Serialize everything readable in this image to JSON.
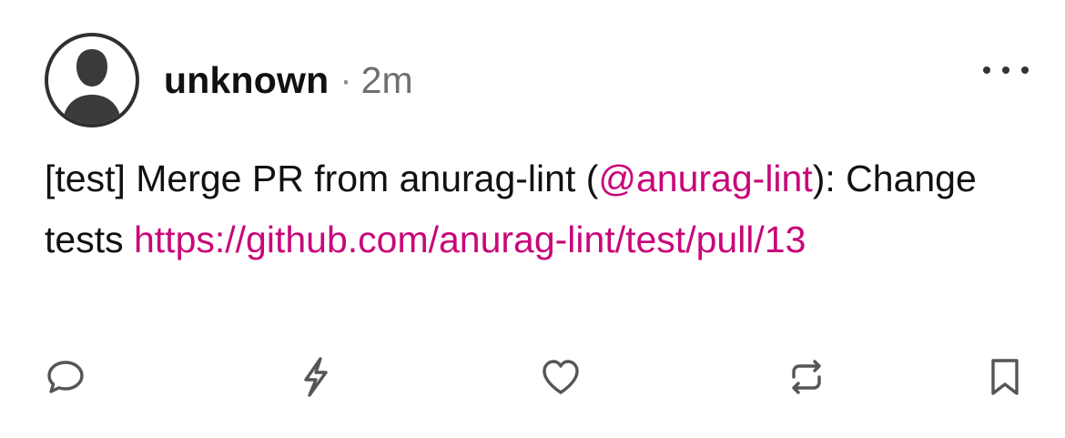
{
  "post": {
    "username": "unknown",
    "separator": "·",
    "time": "2m",
    "text_prefix": "[test] Merge PR from anurag-lint (",
    "mention": "@anurag-lint",
    "text_middle": "): Change tests ",
    "link": "https://github.com/anurag-lint/test/pull/13"
  },
  "icons": {
    "avatar": "default-user-avatar-icon",
    "more": "more-horizontal-icon",
    "reply": "comment-bubble-icon",
    "boost": "lightning-bolt-icon",
    "like": "heart-icon",
    "repost": "repeat-icon",
    "bookmark": "bookmark-icon"
  },
  "colors": {
    "link": "#c8077a",
    "text": "#111111",
    "muted": "#6f6f6f",
    "icon": "#555555"
  }
}
